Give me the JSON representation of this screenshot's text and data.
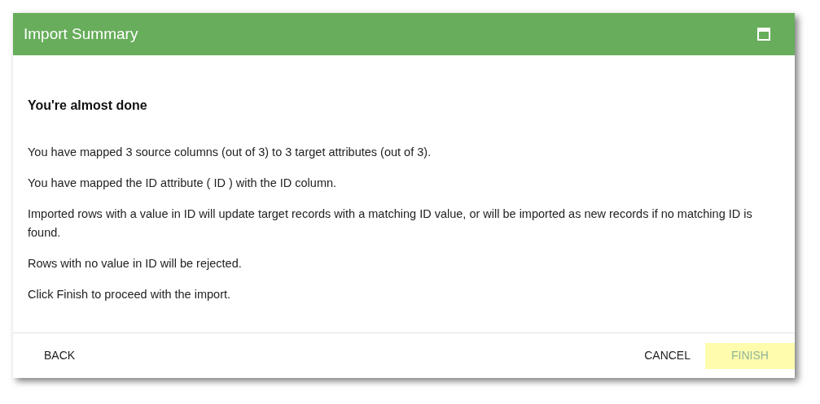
{
  "window": {
    "title": "Import Summary"
  },
  "heading": "You're almost done",
  "paragraphs": [
    "You have mapped 3 source columns (out of 3) to 3 target attributes (out of 3).",
    "You have mapped the ID attribute ( ID ) with the ID column.",
    "Imported rows with a value in ID will update target records with a matching ID value, or will be imported as new records if no matching ID is found.",
    "Rows with no value in ID will be rejected.",
    "Click Finish to proceed with the import."
  ],
  "buttons": [
    {
      "label": "BACK",
      "disabled": false
    },
    {
      "label": "CANCEL",
      "disabled": false
    },
    {
      "label": "FINISH",
      "disabled": true
    }
  ]
}
